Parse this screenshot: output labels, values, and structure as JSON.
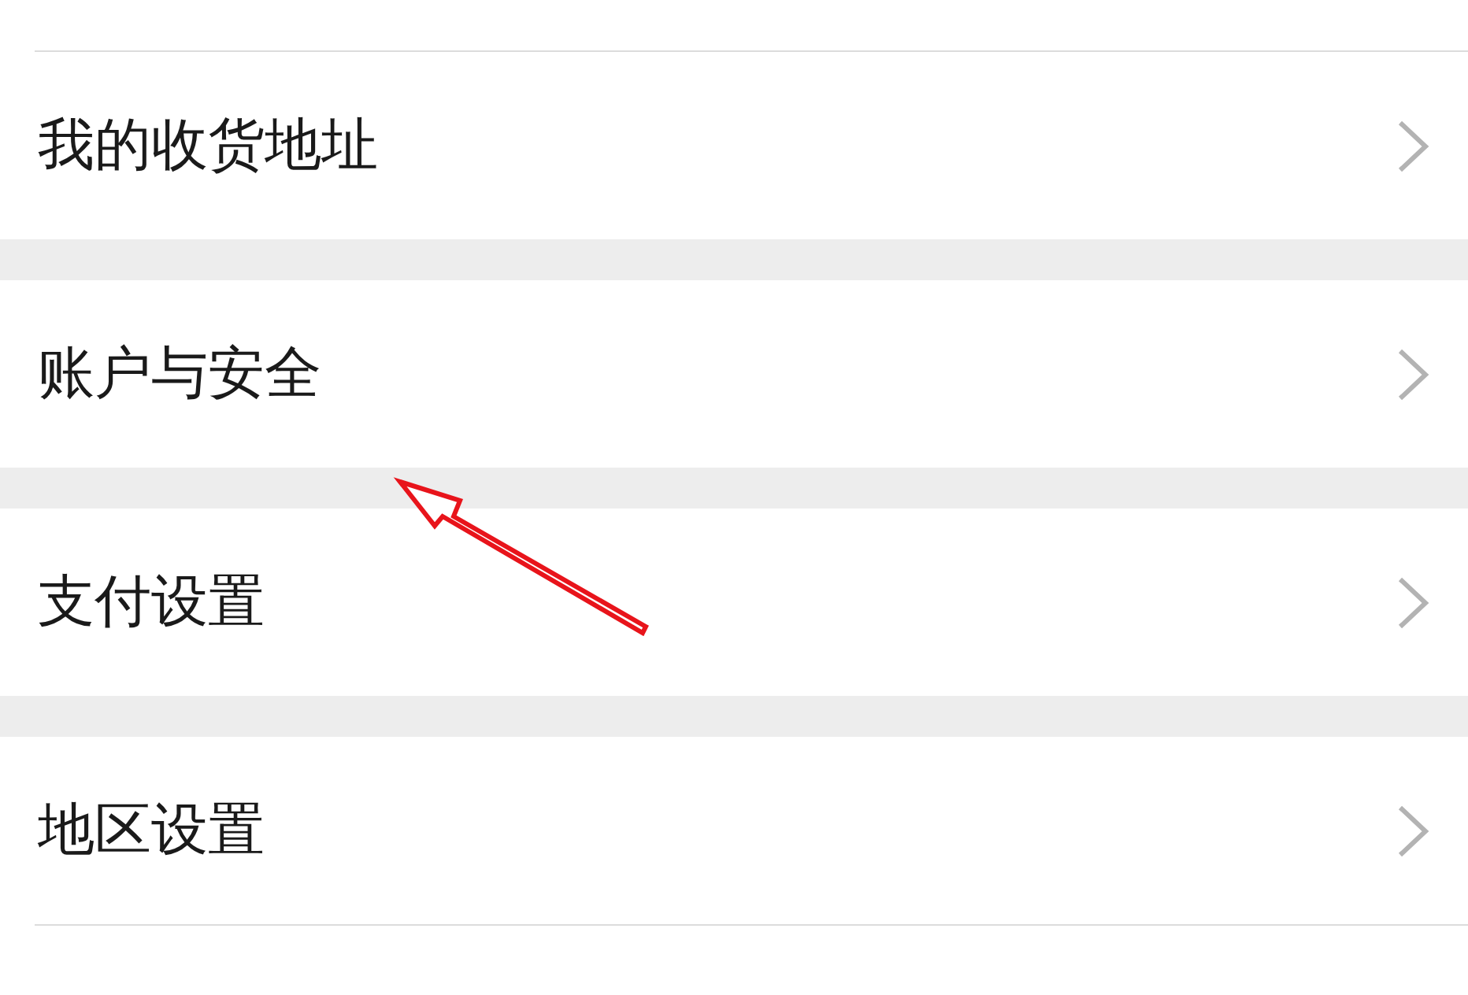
{
  "menu_groups": [
    {
      "items": [
        {
          "label": "我的收货地址"
        }
      ]
    },
    {
      "items": [
        {
          "label": "账户与安全"
        }
      ]
    },
    {
      "items": [
        {
          "label": "支付设置"
        }
      ]
    },
    {
      "items": [
        {
          "label": "地区设置"
        }
      ]
    }
  ]
}
